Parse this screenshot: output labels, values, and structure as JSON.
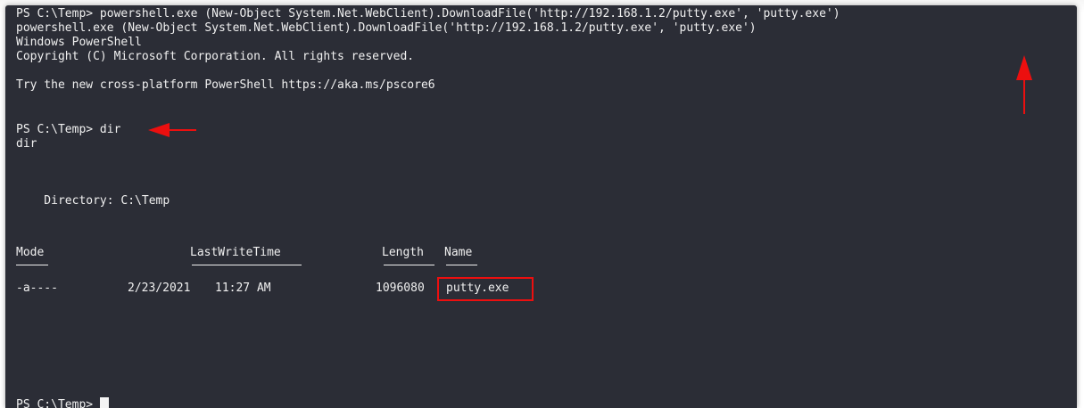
{
  "terminal": {
    "lines": {
      "cmd1": "PS C:\\Temp> powershell.exe (New-Object System.Net.WebClient).DownloadFile('http://192.168.1.2/putty.exe', 'putty.exe')",
      "echo1": "powershell.exe (New-Object System.Net.WebClient).DownloadFile('http://192.168.1.2/putty.exe', 'putty.exe')",
      "banner_title": "Windows PowerShell",
      "banner_copyright": "Copyright (C) Microsoft Corporation. All rights reserved.",
      "banner_try": "Try the new cross-platform PowerShell https://aka.ms/pscore6",
      "prompt_dir": "PS C:\\Temp> dir",
      "echo_dir": "dir",
      "directory": "    Directory: C:\\Temp",
      "final_prompt": "PS C:\\Temp> "
    },
    "listing": {
      "headers": {
        "mode": "Mode",
        "last_write_time": "LastWriteTime",
        "length": "Length",
        "name": "Name"
      },
      "rows": [
        {
          "mode": "-a----",
          "date": "2/23/2021",
          "time": "11:27 AM",
          "length": "1096080",
          "name": "putty.exe"
        }
      ]
    }
  },
  "annotations": {
    "color": "#ec0f0f",
    "arrow_up_icon": "arrow-up-icon",
    "arrow_left_icon": "arrow-left-icon",
    "highlight_box": "putty.exe"
  }
}
